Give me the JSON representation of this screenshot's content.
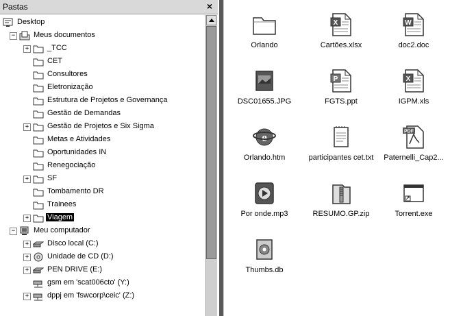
{
  "folder_pane": {
    "title": "Pastas",
    "close": "×",
    "tree": [
      {
        "label": "Desktop",
        "icon": "desktop-icon",
        "expander": "",
        "depth": 0
      },
      {
        "label": "Meus documentos",
        "icon": "my-documents-icon",
        "expander": "−",
        "depth": 1
      },
      {
        "label": "_TCC",
        "icon": "folder-icon",
        "expander": "+",
        "depth": 2
      },
      {
        "label": "CET",
        "icon": "folder-icon",
        "expander": "",
        "depth": 2
      },
      {
        "label": "Consultores",
        "icon": "folder-icon",
        "expander": "",
        "depth": 2
      },
      {
        "label": "Eletronização",
        "icon": "folder-icon",
        "expander": "",
        "depth": 2
      },
      {
        "label": "Estrutura de Projetos e Governança",
        "icon": "folder-icon",
        "expander": "",
        "depth": 2
      },
      {
        "label": "Gestão de Demandas",
        "icon": "folder-icon",
        "expander": "",
        "depth": 2
      },
      {
        "label": "Gestão de Projetos e Six Sigma",
        "icon": "folder-icon",
        "expander": "+",
        "depth": 2
      },
      {
        "label": "Metas e Atividades",
        "icon": "folder-icon",
        "expander": "",
        "depth": 2
      },
      {
        "label": "Oportunidades IN",
        "icon": "folder-icon",
        "expander": "",
        "depth": 2
      },
      {
        "label": "Renegociação",
        "icon": "folder-icon",
        "expander": "",
        "depth": 2
      },
      {
        "label": "SF",
        "icon": "folder-icon",
        "expander": "+",
        "depth": 2
      },
      {
        "label": "Tombamento DR",
        "icon": "folder-icon",
        "expander": "",
        "depth": 2
      },
      {
        "label": "Trainees",
        "icon": "folder-icon",
        "expander": "",
        "depth": 2
      },
      {
        "label": "Viagem",
        "icon": "folder-icon",
        "expander": "+",
        "depth": 2,
        "selected": true
      },
      {
        "label": "Meu computador",
        "icon": "my-computer-icon",
        "expander": "−",
        "depth": 1
      },
      {
        "label": "Disco local (C:)",
        "icon": "local-disk-icon",
        "expander": "+",
        "depth": 2
      },
      {
        "label": "Unidade de CD (D:)",
        "icon": "cd-drive-icon",
        "expander": "+",
        "depth": 2
      },
      {
        "label": "PEN DRIVE (E:)",
        "icon": "removable-drive-icon",
        "expander": "+",
        "depth": 2
      },
      {
        "label": "gsm em 'scat006cto' (Y:)",
        "icon": "network-drive-icon",
        "expander": "",
        "depth": 2
      },
      {
        "label": "dppj em 'fswcorp\\ceic' (Z:)",
        "icon": "network-drive-icon",
        "expander": "+",
        "depth": 2
      }
    ]
  },
  "files": [
    {
      "name": "Orlando",
      "icon": "folder-icon"
    },
    {
      "name": "Cartões.xlsx",
      "icon": "excel-document-icon"
    },
    {
      "name": "doc2.doc",
      "icon": "word-document-icon"
    },
    {
      "name": "DSC01655.JPG",
      "icon": "image-file-icon"
    },
    {
      "name": "FGTS.ppt",
      "icon": "powerpoint-document-icon"
    },
    {
      "name": "IGPM.xls",
      "icon": "excel-document-icon"
    },
    {
      "name": "Orlando.htm",
      "icon": "html-document-icon"
    },
    {
      "name": "participantes cet.txt",
      "icon": "text-document-icon"
    },
    {
      "name": "Paternelli_Cap2...",
      "icon": "pdf-document-icon"
    },
    {
      "name": "Por onde.mp3",
      "icon": "audio-file-icon"
    },
    {
      "name": "RESUMO.GP.zip",
      "icon": "zip-archive-icon"
    },
    {
      "name": "Torrent.exe",
      "icon": "executable-icon"
    },
    {
      "name": "Thumbs.db",
      "icon": "system-file-icon"
    }
  ]
}
